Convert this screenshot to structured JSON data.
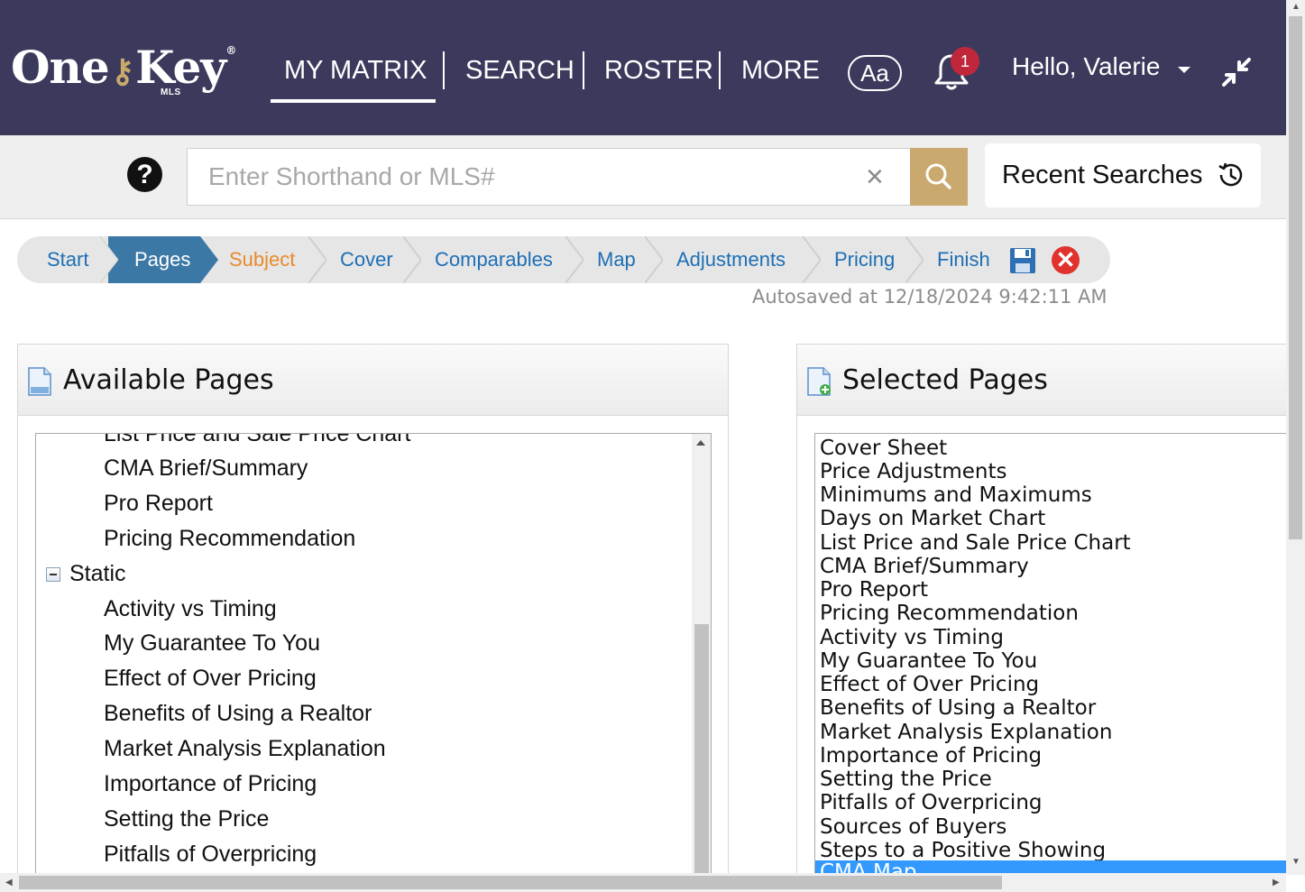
{
  "header": {
    "logo": {
      "text_one": "One",
      "text_key": "Key",
      "reg": "®",
      "mls": "MLS"
    },
    "nav": [
      "MY MATRIX",
      "SEARCH",
      "ROSTER",
      "MORE"
    ],
    "font_button": "Aa",
    "notification_count": "1",
    "greeting": "Hello, Valerie"
  },
  "search": {
    "placeholder": "Enter Shorthand or MLS#",
    "clear": "×",
    "recent_label": "Recent Searches",
    "help": "?"
  },
  "breadcrumb": {
    "steps": [
      "Start",
      "Pages",
      "Subject",
      "Cover",
      "Comparables",
      "Map",
      "Adjustments",
      "Pricing",
      "Finish"
    ],
    "active": "Pages",
    "cancel": "✕",
    "autosave": "Autosaved at 12/18/2024 9:42:11 AM"
  },
  "available": {
    "title": "Available Pages",
    "partial_top": "List Price and Sale Price Chart",
    "items_top": [
      "CMA Brief/Summary",
      "Pro Report",
      "Pricing Recommendation"
    ],
    "group": "Static",
    "items_static": [
      "Activity vs Timing",
      "My Guarantee To You",
      "Effect of Over Pricing",
      "Benefits of Using a Realtor",
      "Market Analysis Explanation",
      "Importance of Pricing",
      "Setting the Price",
      "Pitfalls of Overpricing"
    ]
  },
  "selected": {
    "title": "Selected Pages",
    "items": [
      "Cover Sheet",
      "Price Adjustments",
      "Minimums and Maximums",
      "Days on Market Chart",
      "List Price and Sale Price Chart",
      "CMA Brief/Summary",
      "Pro Report",
      "Pricing Recommendation",
      "Activity vs Timing",
      "My Guarantee To You",
      "Effect of Over Pricing",
      "Benefits of Using a Realtor",
      "Market Analysis Explanation",
      "Importance of Pricing",
      "Setting the Price",
      "Pitfalls of Overpricing",
      "Sources of Buyers",
      "Steps to a Positive Showing"
    ],
    "highlighted_partial": "CMA Map"
  },
  "colors": {
    "nav_bg": "#3b3a5c",
    "accent_gold": "#c9a96e",
    "active_step": "#3b78a6",
    "current_step": "#e88a2c",
    "link_blue": "#1e6fb5",
    "selection": "#3399ff"
  },
  "icons": [
    "help-icon",
    "clear-icon",
    "search-icon",
    "history-icon",
    "bell-icon",
    "compress-icon",
    "save-icon",
    "cancel-icon",
    "page-icon",
    "page-add-icon",
    "collapse-icon"
  ]
}
